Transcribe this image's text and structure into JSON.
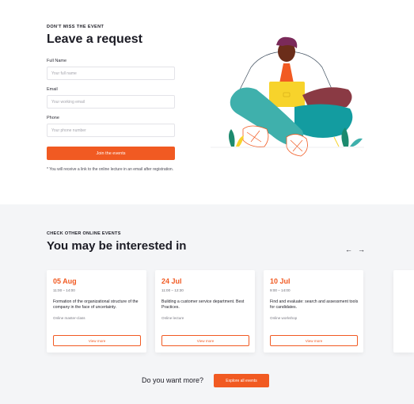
{
  "request": {
    "eyebrow": "DON'T MISS THE EVENT",
    "title": "Leave a request",
    "fields": [
      {
        "label": "Full Name",
        "placeholder": "Your full name"
      },
      {
        "label": "Email",
        "placeholder": "Your working email"
      },
      {
        "label": "Phone",
        "placeholder": "Your phone number"
      }
    ],
    "submit_label": "Join the events",
    "note": "* You will receive a link to the online lecture in an email after registration."
  },
  "events": {
    "eyebrow": "CHECK OTHER ONLINE EVENTS",
    "title": "You may be interested in",
    "prev_icon": "←",
    "next_icon": "→",
    "cards": [
      {
        "date": "05 Aug",
        "time": "11:00 – 14:00",
        "title": "Formation of the organizational structure of the company in the face of uncertainty.",
        "kind": "Online master-class",
        "button": "View more"
      },
      {
        "date": "24 Jul",
        "time": "11:00 – 12:30",
        "title": "Building a customer service department. Best Practices.",
        "kind": "Online lecture",
        "button": "View more"
      },
      {
        "date": "10 Jul",
        "time": "9:00 – 14:00",
        "title": "Find and evaluate: search and assessment tools for candidates.",
        "kind": "Online workshop",
        "button": "View more"
      }
    ]
  },
  "footer": {
    "question": "Do you want more?",
    "explore_label": "Explore all events"
  },
  "colors": {
    "accent": "#f15a22",
    "section_bg": "#f4f5f7"
  },
  "icons": {
    "illustration": "person-with-laptop-illustration"
  }
}
